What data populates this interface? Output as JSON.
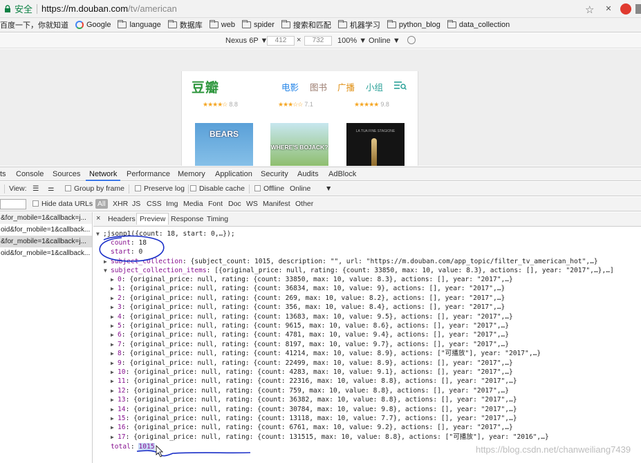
{
  "browser": {
    "secure_label": "安全",
    "url_host": "https://m.douban.com",
    "url_path": "/tv/american",
    "bookmarks": [
      "百度一下，你就知道",
      "Google",
      "language",
      "数据库",
      "web",
      "spider",
      "搜索和匹配",
      "机器学习",
      "python_blog",
      "data_collection"
    ]
  },
  "device_toolbar": {
    "device": "Nexus 6P ▼",
    "width": "412",
    "height": "732",
    "times": "×",
    "zoom": "100% ▼",
    "throttle": "Online ▼"
  },
  "page": {
    "logo": "豆瓣",
    "nav": [
      "电影",
      "图书",
      "广播",
      "小组"
    ],
    "nav_colors": [
      "#2384e8",
      "#9b7c6f",
      "#e09015",
      "#2aa198"
    ],
    "ratings": [
      {
        "stars": "★★★★☆",
        "value": "8.8"
      },
      {
        "stars": "★★★☆☆",
        "value": "7.1"
      },
      {
        "stars": "★★★★★",
        "value": "9.8"
      }
    ],
    "posters": [
      "BEARS",
      "WHERE'S BOJACK?",
      "LA TUA FINE STAGIONE"
    ]
  },
  "devtools": {
    "tabs": [
      "ts",
      "Console",
      "Sources",
      "Network",
      "Performance",
      "Memory",
      "Application",
      "Security",
      "Audits",
      "AdBlock"
    ],
    "active_tab": "Network",
    "controls": {
      "view": "View:",
      "group_by_frame": "Group by frame",
      "preserve_log": "Preserve log",
      "disable_cache": "Disable cache",
      "offline": "Offline",
      "online": "Online",
      "dropdown": "▼"
    },
    "filter": {
      "hide_data_urls": "Hide data URLs",
      "types": [
        "All",
        "XHR",
        "JS",
        "CSS",
        "Img",
        "Media",
        "Font",
        "Doc",
        "WS",
        "Manifest",
        "Other"
      ]
    },
    "requests": [
      "&for_mobile=1&callback=j...",
      "oid&for_mobile=1&callback...",
      "&for_mobile=1&callback=j...",
      "oid&for_mobile=1&callback..."
    ],
    "detail_tabs": [
      "×",
      "Headers",
      "Preview",
      "Response",
      "Timing"
    ],
    "active_detail_tab": "Preview"
  },
  "preview": {
    "root": ";jsonp1({count: 18, start: 0,…});",
    "count_key": "count",
    "count_val": "18",
    "start_key": "start",
    "start_val": "0",
    "subject_collection_key": "subject_collection",
    "subject_collection_val": "{subject_count: 1015, description: \"\", url: \"https://m.douban.com/app_topic/filter_tv_american_hot\",…}",
    "items_key": "subject_collection_items",
    "items_val": "[{original_price: null, rating: {count: 33850, max: 10, value: 8.3}, actions: [], year: \"2017\",…},…]",
    "items": [
      {
        "i": "0",
        "v": "{original_price: null, rating: {count: 33850, max: 10, value: 8.3}, actions: [], year: \"2017\",…}"
      },
      {
        "i": "1",
        "v": "{original_price: null, rating: {count: 36834, max: 10, value: 9}, actions: [], year: \"2017\",…}"
      },
      {
        "i": "2",
        "v": "{original_price: null, rating: {count: 269, max: 10, value: 8.2}, actions: [], year: \"2017\",…}"
      },
      {
        "i": "3",
        "v": "{original_price: null, rating: {count: 356, max: 10, value: 8.4}, actions: [], year: \"2017\",…}"
      },
      {
        "i": "4",
        "v": "{original_price: null, rating: {count: 13683, max: 10, value: 9.5}, actions: [], year: \"2017\",…}"
      },
      {
        "i": "5",
        "v": "{original_price: null, rating: {count: 9615, max: 10, value: 8.6}, actions: [], year: \"2017\",…}"
      },
      {
        "i": "6",
        "v": "{original_price: null, rating: {count: 4781, max: 10, value: 9.4}, actions: [], year: \"2017\",…}"
      },
      {
        "i": "7",
        "v": "{original_price: null, rating: {count: 8197, max: 10, value: 9.7}, actions: [], year: \"2017\",…}"
      },
      {
        "i": "8",
        "v": "{original_price: null, rating: {count: 41214, max: 10, value: 8.9}, actions: [\"可播放\"], year: \"2017\",…}"
      },
      {
        "i": "9",
        "v": "{original_price: null, rating: {count: 22499, max: 10, value: 8.9}, actions: [], year: \"2017\",…}"
      },
      {
        "i": "10",
        "v": "{original_price: null, rating: {count: 4283, max: 10, value: 9.1}, actions: [], year: \"2017\",…}"
      },
      {
        "i": "11",
        "v": "{original_price: null, rating: {count: 22316, max: 10, value: 8.8}, actions: [], year: \"2017\",…}"
      },
      {
        "i": "12",
        "v": "{original_price: null, rating: {count: 759, max: 10, value: 8.8}, actions: [], year: \"2017\",…}"
      },
      {
        "i": "13",
        "v": "{original_price: null, rating: {count: 36382, max: 10, value: 8.8}, actions: [], year: \"2017\",…}"
      },
      {
        "i": "14",
        "v": "{original_price: null, rating: {count: 30784, max: 10, value: 9.8}, actions: [], year: \"2017\",…}"
      },
      {
        "i": "15",
        "v": "{original_price: null, rating: {count: 13118, max: 10, value: 7.7}, actions: [], year: \"2017\",…}"
      },
      {
        "i": "16",
        "v": "{original_price: null, rating: {count: 6761, max: 10, value: 9.2}, actions: [], year: \"2017\",…}"
      },
      {
        "i": "17",
        "v": "{original_price: null, rating: {count: 131515, max: 10, value: 8.8}, actions: [\"可播放\"], year: \"2016\",…}"
      }
    ],
    "total_key": "total",
    "total_val": "1015"
  },
  "watermark": "https://blog.csdn.net/chanweiliang7439",
  "annotation_color": "#1a2fc8"
}
